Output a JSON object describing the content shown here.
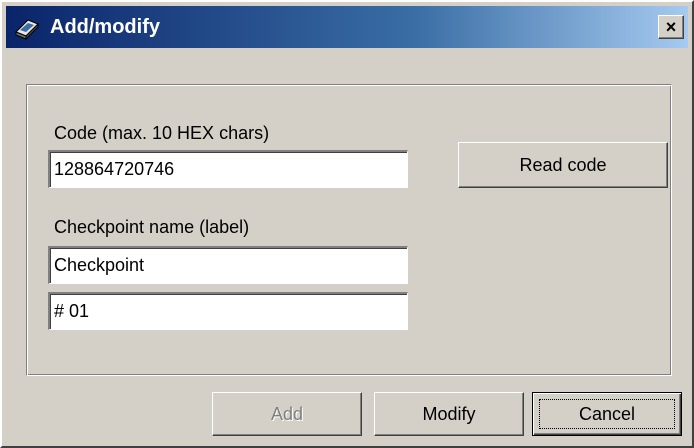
{
  "window": {
    "title": "Add/modify",
    "close_label": "×"
  },
  "form": {
    "code_label": "Code (max. 10 HEX chars)",
    "code_value": "128864720746",
    "name_label": "Checkpoint name (label)",
    "name_value": "Checkpoint",
    "extra_value": "# 01",
    "read_code_label": "Read code"
  },
  "buttons": {
    "add_label": "Add",
    "modify_label": "Modify",
    "cancel_label": "Cancel"
  },
  "icons": {
    "app": "book-icon",
    "close": "close-icon"
  }
}
